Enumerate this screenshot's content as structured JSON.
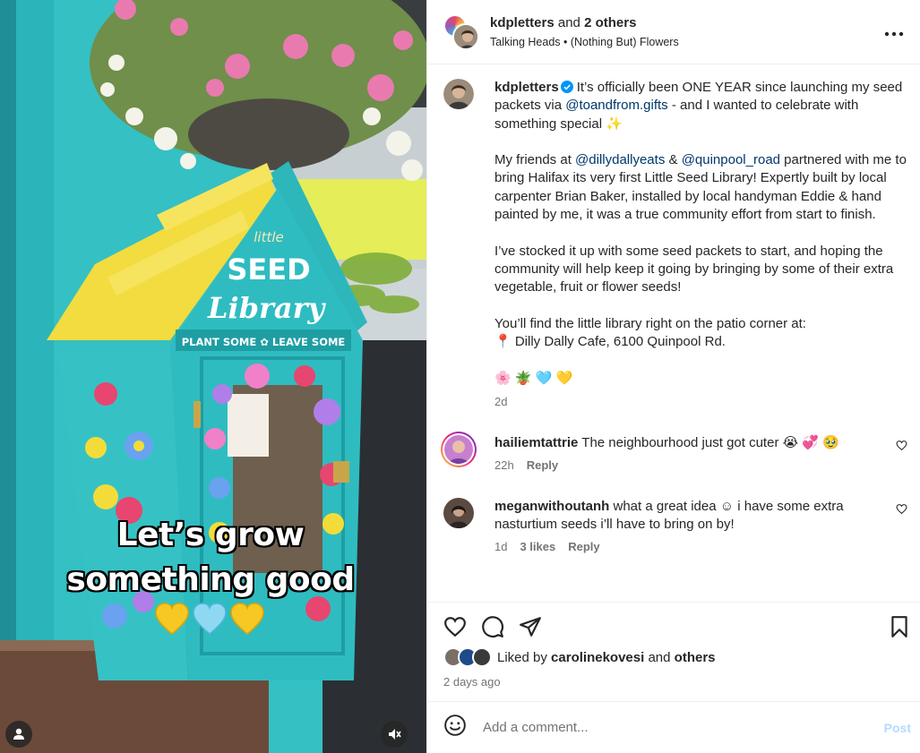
{
  "media": {
    "overlay_line1": "Let’s grow",
    "overlay_line2": "something good",
    "sign_small": "little",
    "sign_big1": "SEED",
    "sign_big2": "Library",
    "sign_banner": "PLANT SOME ✿ LEAVE SOME"
  },
  "header": {
    "username": "kdpletters",
    "and_text": "and",
    "others": "2 others",
    "audio": "Talking Heads • (Nothing But) Flowers"
  },
  "caption": {
    "username": "kdpletters",
    "p1_a": "It’s officially been ONE YEAR since launching my seed packets via",
    "p1_mention": "@toandfrom.gifts",
    "p1_b": "- and I wanted to celebrate with something special ✨",
    "p2_a": "My friends at",
    "p2_m1": "@dillydallyeats",
    "p2_amp": "&",
    "p2_m2": "@quinpool_road",
    "p2_b": "partnered with me to bring Halifax its very first Little Seed Library! Expertly built by local carpenter Brian Baker, installed by local handyman Eddie & hand painted by me, it was a true community effort from start to finish.",
    "p3": "I’ve stocked it up with some seed packets to start, and hoping the community will help keep it going by bringing by some of their extra vegetable, fruit or flower seeds!",
    "p4_a": "You’ll find the little library right on the patio corner at:",
    "p4_b": "📍 Dilly Dally Cafe, 6100 Quinpool Rd.",
    "p5_emoji": "🌸 🪴 🩵 💛",
    "time": "2d"
  },
  "comments": [
    {
      "username": "hailiemtattrie",
      "text": "The neighbourhood just got cuter 😭 💞 🥹",
      "time": "22h",
      "reply": "Reply"
    },
    {
      "username": "meganwithoutanh",
      "text": "what a great idea ☺ i have some extra nasturtium seeds i’ll have to bring on by!",
      "time": "1d",
      "likes": "3 likes",
      "reply": "Reply"
    }
  ],
  "actions": {
    "liked_by_prefix": "Liked by",
    "liked_by_user": "carolinekovesi",
    "liked_by_and": "and",
    "liked_by_others": "others",
    "date": "2 days ago"
  },
  "comment_box": {
    "placeholder": "Add a comment...",
    "post_label": "Post"
  },
  "colors": {
    "mention": "#00376b",
    "meta": "#737373",
    "verified": "#0095f6",
    "post_disabled": "#b3dbff",
    "box_teal": "#2ab5b8",
    "roof_yellow": "#f5e04a"
  },
  "icons": [
    "more-options-icon",
    "verified-badge-icon",
    "heart-icon",
    "comment-icon",
    "share-icon",
    "save-icon",
    "emoji-icon",
    "user-tag-icon",
    "mute-icon"
  ]
}
